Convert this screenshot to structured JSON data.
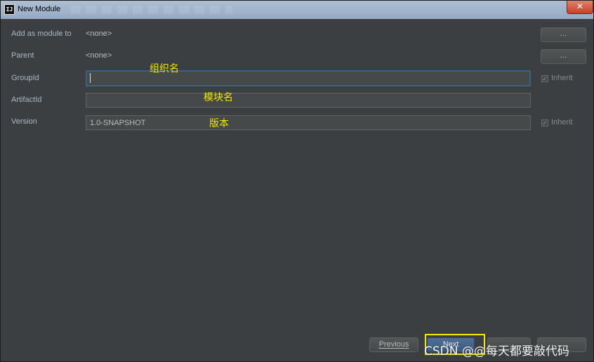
{
  "window": {
    "title": "New Module",
    "close_glyph": "✕",
    "app_icon_glyph": "IJ"
  },
  "form": {
    "add_as_module": {
      "label": "Add as module to",
      "value": "<none>",
      "browse_label": "..."
    },
    "parent": {
      "label": "Parent",
      "value": "<none>",
      "browse_label": "..."
    },
    "group_id": {
      "label": "GroupId",
      "value": "",
      "inherit_label": "Inherit",
      "inherit_checked": true
    },
    "artifact_id": {
      "label": "ArtifactId",
      "value": ""
    },
    "version": {
      "label": "Version",
      "value": "1.0-SNAPSHOT",
      "inherit_label": "Inherit",
      "inherit_checked": true
    }
  },
  "annotations": {
    "group_id": "组织名",
    "artifact_id": "模块名",
    "version": "版本"
  },
  "footer": {
    "previous_label": "Previous",
    "next_label": "Next",
    "cancel_label": "",
    "help_label": ""
  },
  "watermark": "CSDN @@每天都要敲代码",
  "colors": {
    "background": "#3c3f41",
    "field_bg": "#45494a",
    "focus_border": "#3d6185",
    "annotation": "#f3e600"
  }
}
